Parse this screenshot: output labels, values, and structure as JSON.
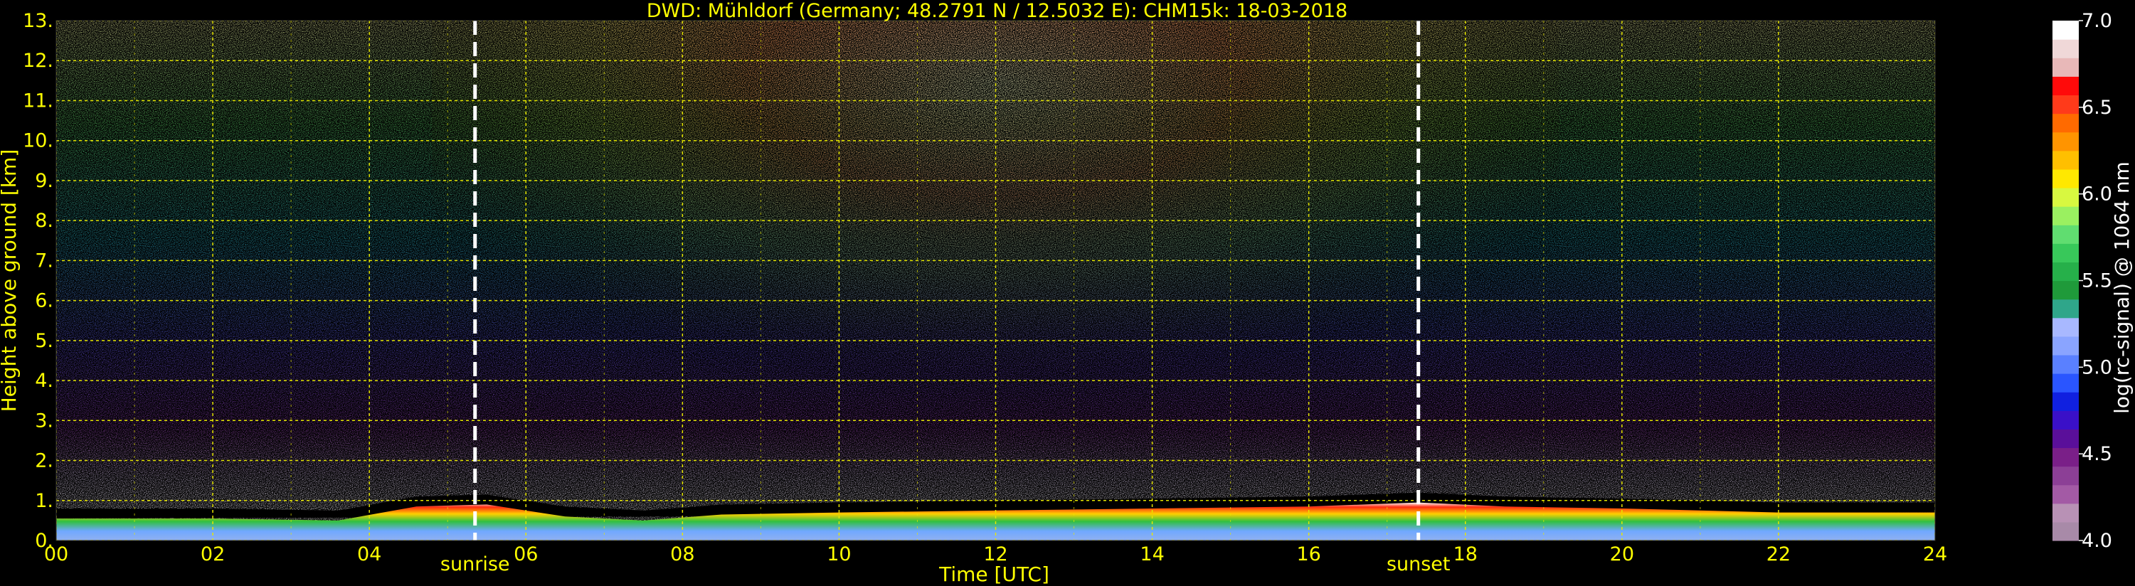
{
  "chart_data": {
    "type": "heatmap",
    "title": "DWD: Mühldorf (Germany; 48.2791 N / 12.5032 E):    CHM15k: 18-03-2018",
    "xlabel": "Time [UTC]",
    "ylabel": "Height above ground [km]",
    "xlim": [
      0,
      24
    ],
    "ylim": [
      0,
      13
    ],
    "x_ticks": [
      "00",
      "02",
      "04",
      "06",
      "08",
      "10",
      "12",
      "14",
      "16",
      "18",
      "20",
      "22",
      "24"
    ],
    "y_ticks": [
      "0.",
      "1.",
      "2.",
      "3.",
      "4.",
      "5.",
      "6.",
      "7.",
      "8.",
      "9.",
      "10.",
      "11.",
      "12.",
      "13."
    ],
    "grid": true,
    "colorbar": {
      "label": "log(rc-signal) @ 1064 nm",
      "range": [
        4.0,
        7.0
      ],
      "ticks": [
        "4.0",
        "4.5",
        "5.0",
        "5.5",
        "6.0",
        "6.5",
        "7.0"
      ],
      "colors": [
        "#a88aa8",
        "#b891b5",
        "#a35aa5",
        "#8c3f96",
        "#7a1f88",
        "#5a0f9a",
        "#3a10c8",
        "#1020e0",
        "#2a55ff",
        "#5a80ff",
        "#8aa4ff",
        "#a8b8ff",
        "#2fa68a",
        "#1f9a3a",
        "#26b04a",
        "#38c85a",
        "#60dd70",
        "#9af060",
        "#d8f840",
        "#ffe800",
        "#ffbf00",
        "#ff9400",
        "#ff6a00",
        "#ff3a1a",
        "#ff0a0a",
        "#e8b8b8",
        "#f0d8d8",
        "#ffffff"
      ]
    },
    "annotations": [
      {
        "text": "sunrise",
        "x": 5.35
      },
      {
        "text": "sunset",
        "x": 17.4
      }
    ],
    "boundary_layer_top_km": [
      [
        0,
        0.55
      ],
      [
        2,
        0.55
      ],
      [
        3.6,
        0.5
      ],
      [
        4.6,
        0.85
      ],
      [
        5.5,
        0.9
      ],
      [
        6.5,
        0.6
      ],
      [
        7.5,
        0.5
      ],
      [
        8.5,
        0.65
      ],
      [
        10,
        0.7
      ],
      [
        12,
        0.75
      ],
      [
        14,
        0.8
      ],
      [
        16,
        0.85
      ],
      [
        17.4,
        0.95
      ],
      [
        18.5,
        0.85
      ],
      [
        20,
        0.8
      ],
      [
        22,
        0.7
      ],
      [
        24,
        0.7
      ]
    ]
  }
}
